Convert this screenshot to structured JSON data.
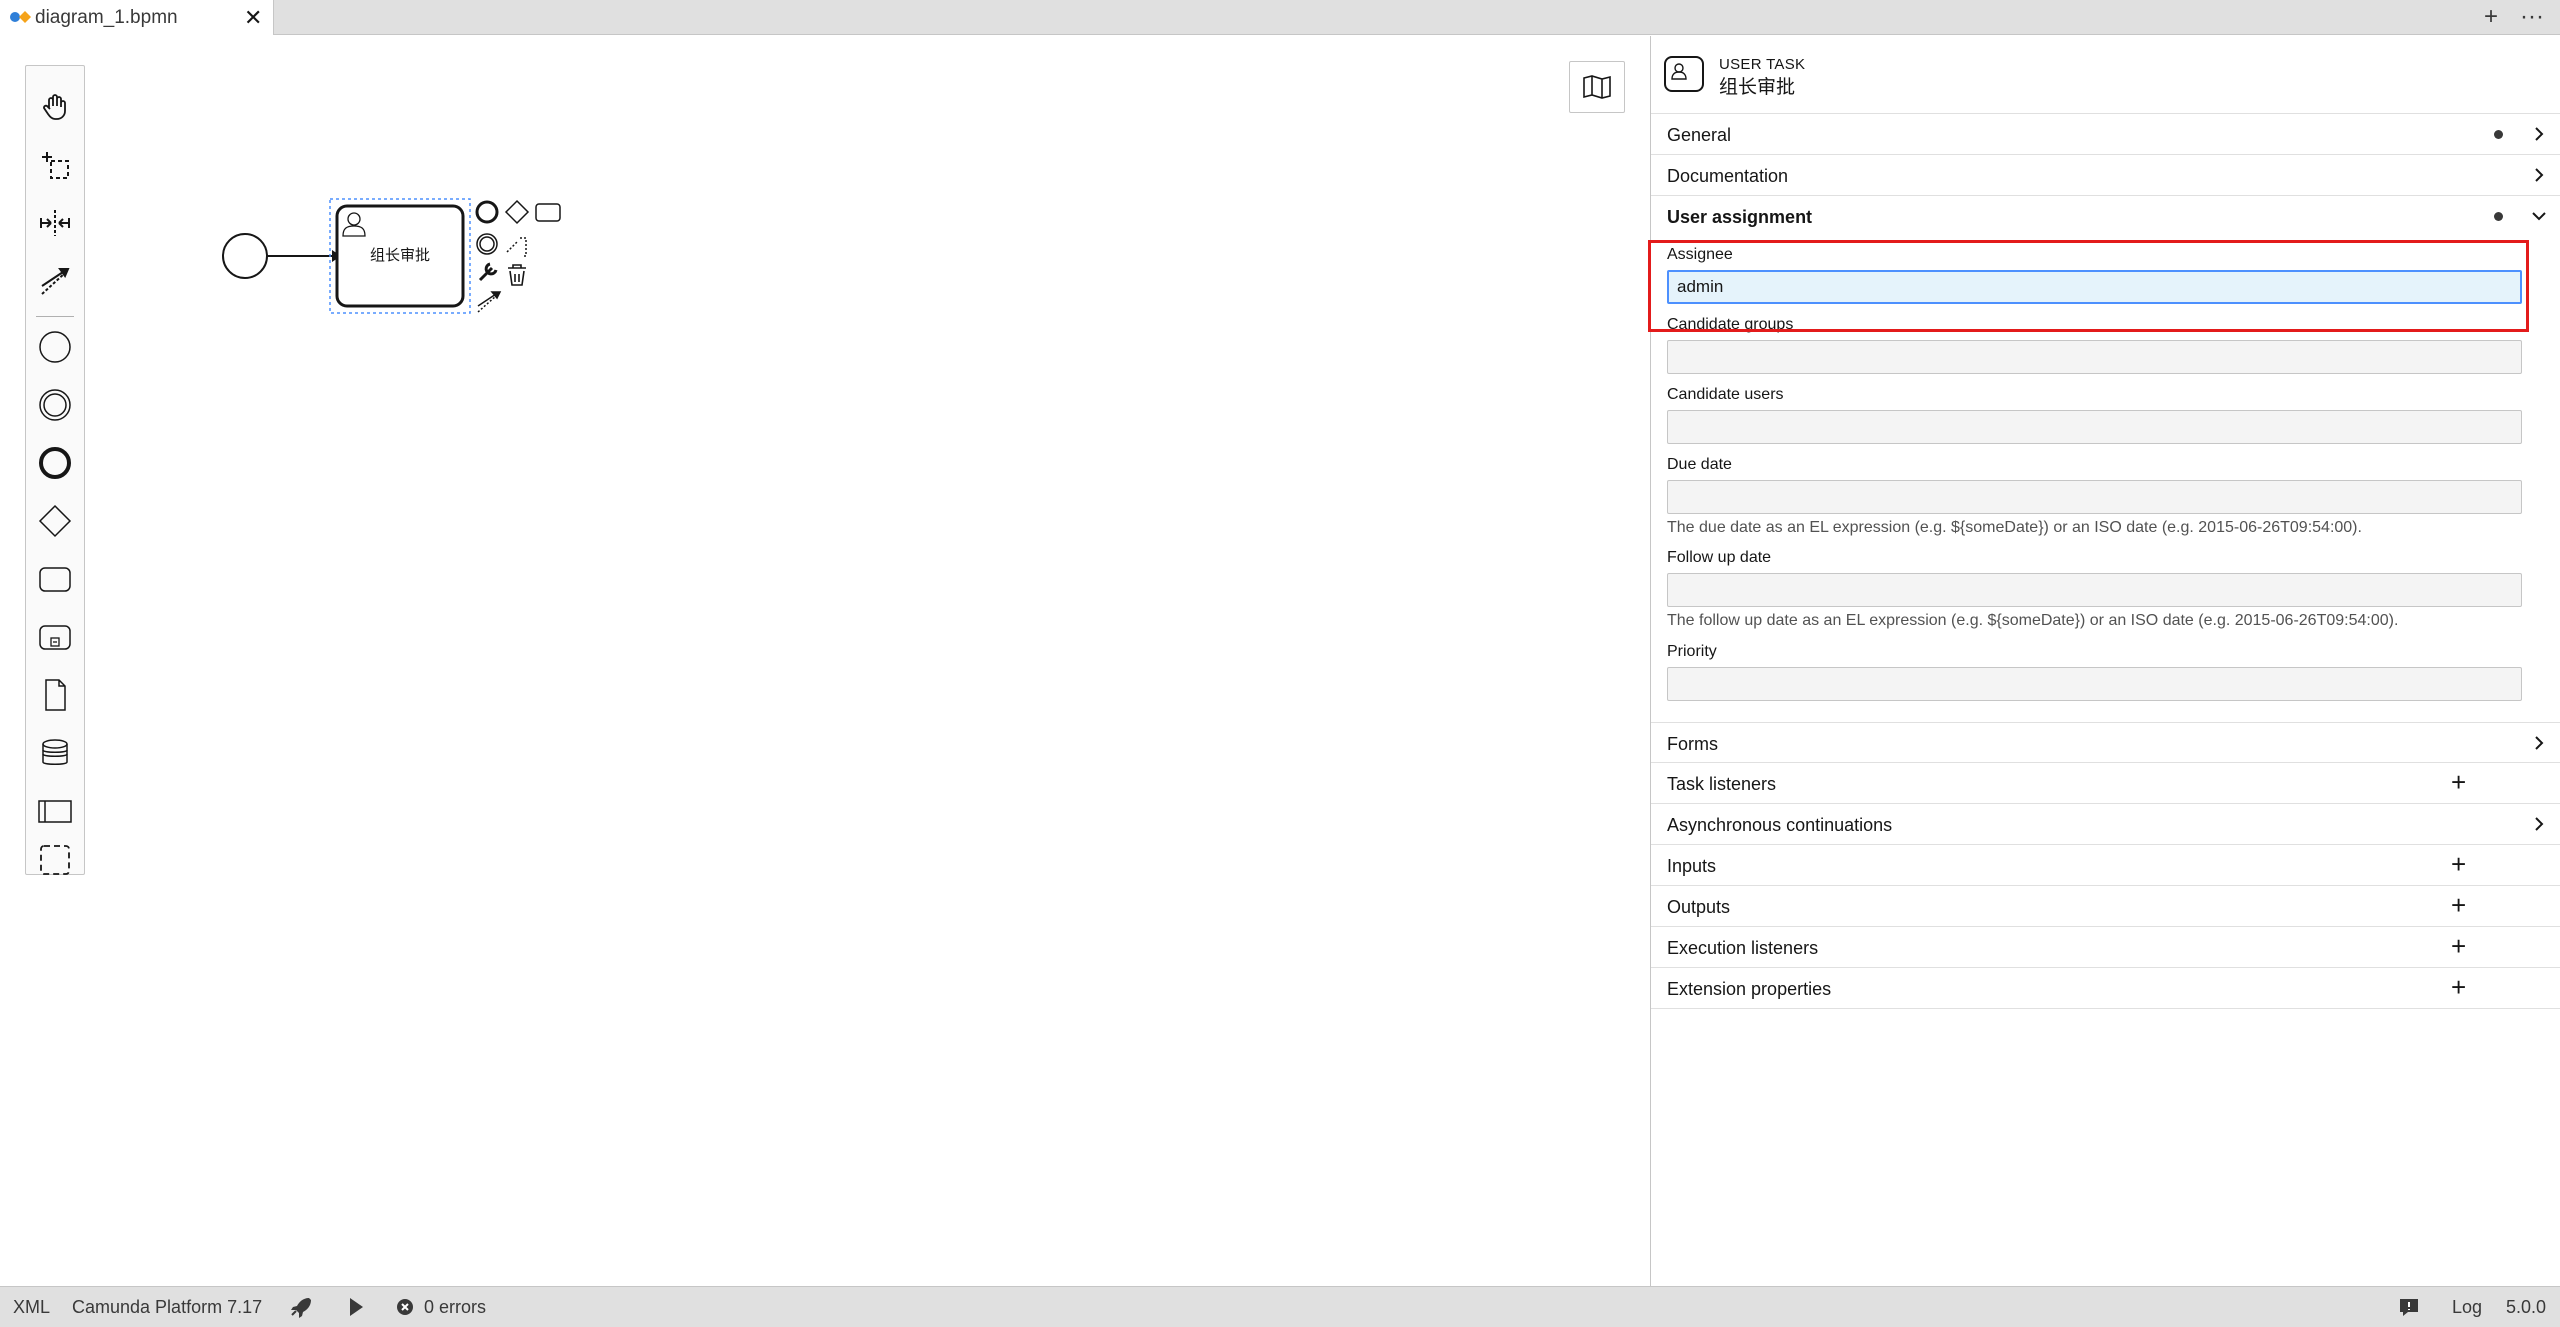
{
  "tab": {
    "filename": "diagram_1.bpmn",
    "close": "✕"
  },
  "tab_actions": {
    "add": "+",
    "more": "···"
  },
  "palette": {
    "tools": [
      "hand-tool-icon",
      "lasso-tool-icon",
      "space-tool-icon",
      "global-connect-icon",
      "start-event-icon",
      "intermediate-event-icon",
      "end-event-icon",
      "gateway-icon",
      "task-icon",
      "subprocess-icon",
      "data-object-icon",
      "data-store-icon",
      "pool-icon",
      "group-icon"
    ]
  },
  "diagram": {
    "task_label": "组长审批"
  },
  "panel": {
    "header": {
      "type": "USER TASK",
      "name": "组长审批"
    },
    "groups_top": [
      {
        "title": "General",
        "indicator": true,
        "icon": "chevron-right"
      },
      {
        "title": "Documentation",
        "indicator": false,
        "icon": "chevron-right"
      },
      {
        "title": "User assignment",
        "indicator": true,
        "icon": "chevron-down",
        "open": true
      }
    ],
    "user_assignment": {
      "assignee_label": "Assignee",
      "assignee_value": "admin",
      "candidate_groups_label": "Candidate groups",
      "candidate_users_label": "Candidate users",
      "due_date_label": "Due date",
      "due_date_desc": "The due date as an EL expression (e.g. ${someDate}) or an ISO date (e.g. 2015-06-26T09:54:00).",
      "follow_up_label": "Follow up date",
      "follow_up_desc": "The follow up date as an EL expression (e.g. ${someDate}) or an ISO date (e.g. 2015-06-26T09:54:00).",
      "priority_label": "Priority"
    },
    "groups_bottom": [
      {
        "title": "Forms",
        "icon": "chevron-right"
      },
      {
        "title": "Task listeners",
        "icon": "plus"
      },
      {
        "title": "Asynchronous continuations",
        "icon": "chevron-right"
      },
      {
        "title": "Inputs",
        "icon": "plus"
      },
      {
        "title": "Outputs",
        "icon": "plus"
      },
      {
        "title": "Execution listeners",
        "icon": "plus"
      },
      {
        "title": "Extension properties",
        "icon": "plus"
      }
    ]
  },
  "statusbar": {
    "xml": "XML",
    "platform": "Camunda Platform 7.17",
    "errors": "0 errors",
    "log": "Log",
    "version": "5.0.0"
  },
  "colors": {
    "highlight": "#e31b1b",
    "focus": "#4d90fe",
    "selection": "#4d90fe"
  }
}
